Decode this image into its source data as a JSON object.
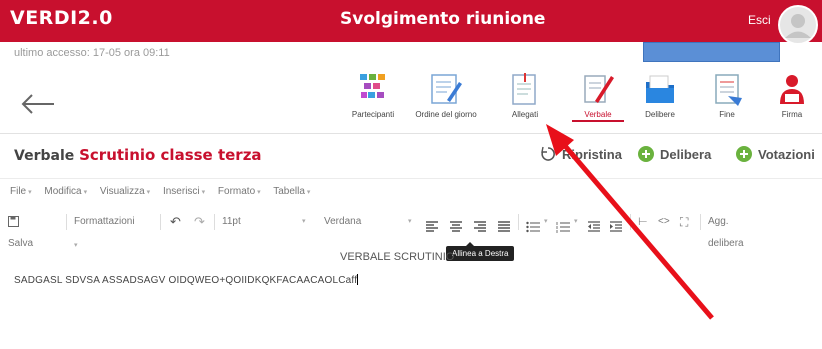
{
  "header": {
    "logo": "VERDI2.0",
    "title": "Svolgimento riunione",
    "exit_label": "Esci",
    "last_access": "ultimo accesso: 17-05 ora 09:11",
    "bg_color": "#c8102e"
  },
  "toolbar": {
    "items": [
      {
        "label": "Partecipanti",
        "icon": "participants-icon"
      },
      {
        "label": "Ordine del giorno",
        "icon": "agenda-icon"
      },
      {
        "label": "Allegati",
        "icon": "attachments-icon"
      },
      {
        "label": "Verbale",
        "icon": "minutes-pen-icon",
        "active": true
      },
      {
        "label": "Delibere",
        "icon": "resolutions-folder-icon"
      },
      {
        "label": "Fine",
        "icon": "end-document-icon"
      },
      {
        "label": "Firma",
        "icon": "signature-person-icon"
      }
    ]
  },
  "verbale": {
    "prefix": "Verbale",
    "name": "Scrutinio classe terza",
    "actions": {
      "ripristina": "Ripristina",
      "delibera": "Delibera",
      "votazioni": "Votazioni"
    }
  },
  "editor": {
    "menu": [
      "File",
      "Modifica",
      "Visualizza",
      "Inserisci",
      "Formato",
      "Tabella"
    ],
    "save": "Salva",
    "formats": "Formattazioni",
    "font_size": "11pt",
    "font_family": "Verdana",
    "add_resolution": "Agg. delibera",
    "tooltip": "Allinea a Destra",
    "doc_heading": "VERBALE SCRUTINIO",
    "doc_text": "SADGASL SDVSA ASSADSAGV OIDQWEO+QOIIDKQKFACAACAOLCaff"
  },
  "annotation": {
    "type": "red-arrow",
    "target": "attachments-icon",
    "color": "#e8101a"
  }
}
